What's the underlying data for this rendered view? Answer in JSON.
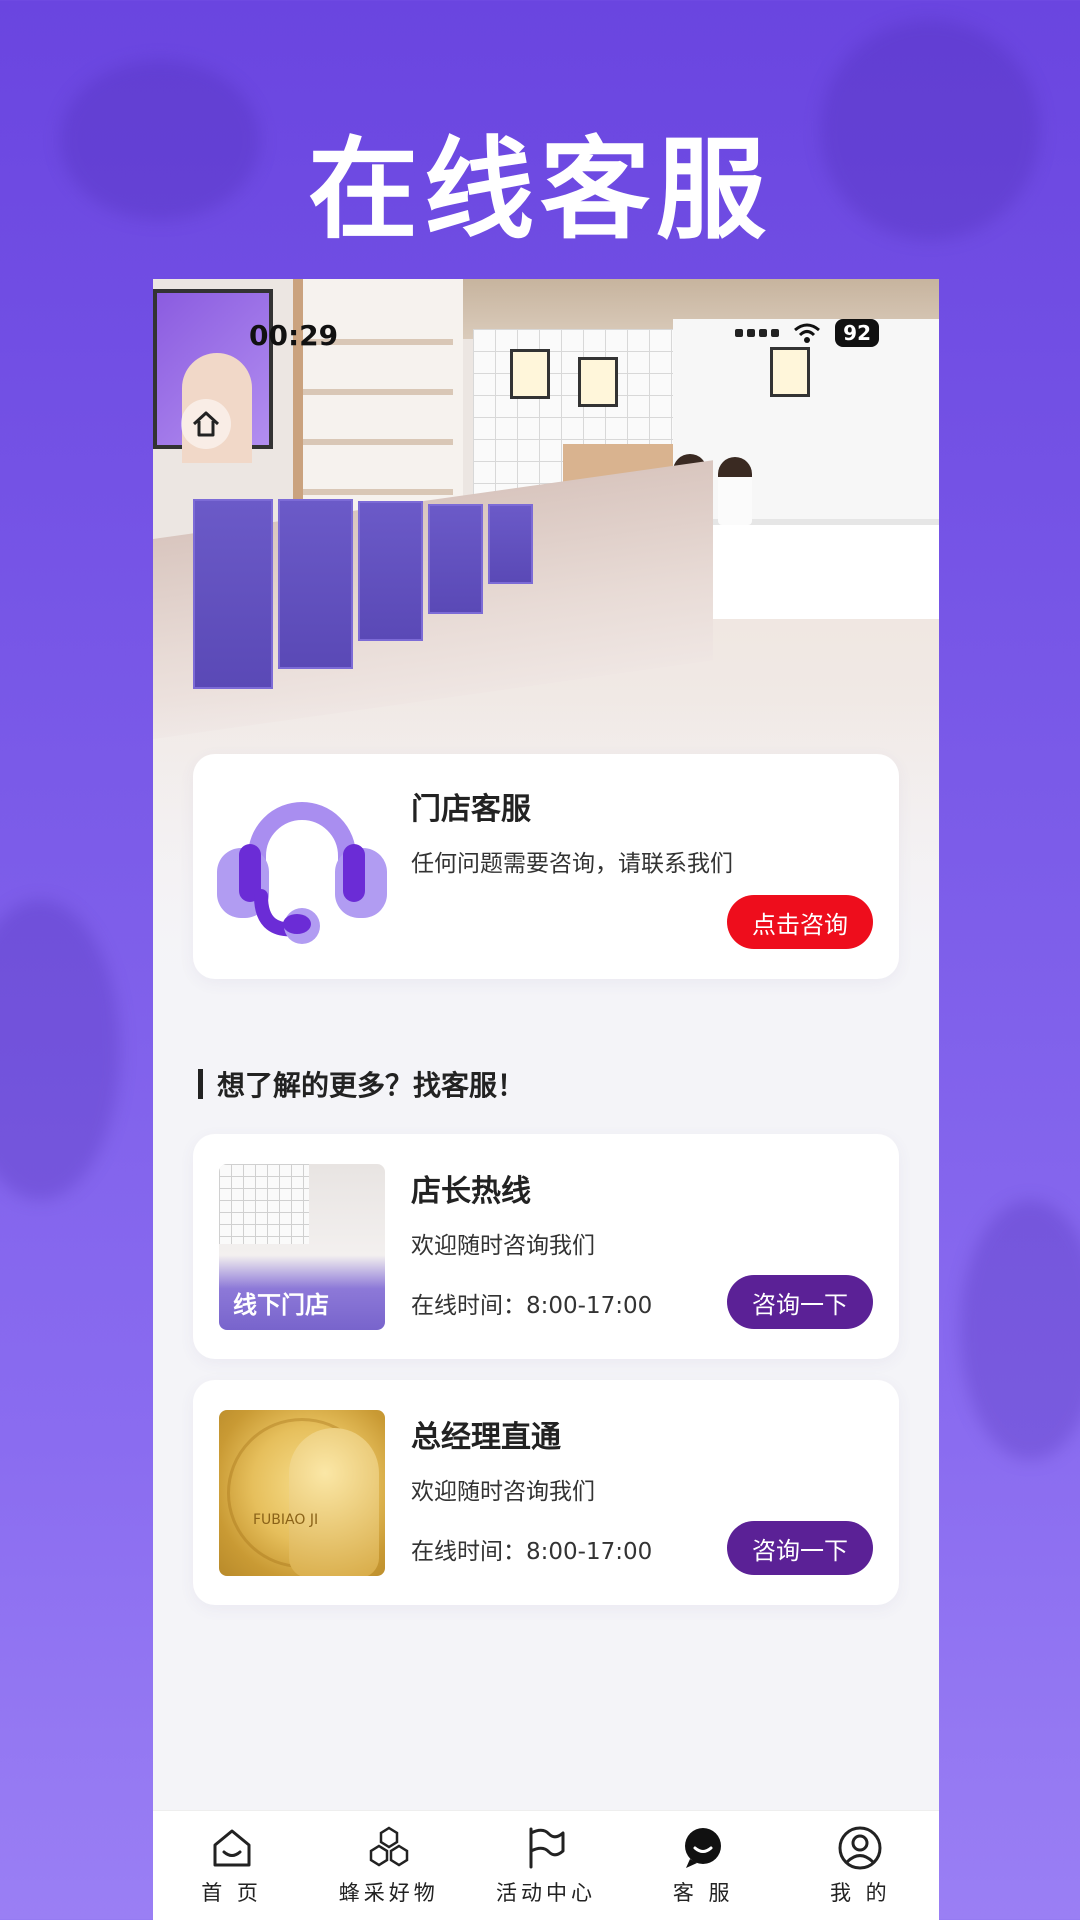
{
  "page_title": "在线客服",
  "status_bar": {
    "time": "00:29",
    "battery": "92"
  },
  "hero": {
    "alt": "store photo"
  },
  "store_card": {
    "title": "门店客服",
    "subtitle": "任何问题需要咨询，请联系我们",
    "button": "点击咨询"
  },
  "section": {
    "heading": "想了解的更多？找客服！"
  },
  "services": [
    {
      "title": "店长热线",
      "desc": "欢迎随时咨询我们",
      "hours": "在线时间：8:00-17:00",
      "image_label": "线下门店",
      "button": "咨询一下"
    },
    {
      "title": "总经理直通",
      "desc": "欢迎随时咨询我们",
      "hours": "在线时间：8:00-17:00",
      "image_label": "FUBIAO JI",
      "button": "咨询一下"
    }
  ],
  "nav": [
    {
      "label": "首 页",
      "icon": "home-icon"
    },
    {
      "label": "蜂采好物",
      "icon": "hexagon-icon"
    },
    {
      "label": "活动中心",
      "icon": "flag-icon"
    },
    {
      "label": "客 服",
      "icon": "chat-icon"
    },
    {
      "label": "我 的",
      "icon": "user-icon"
    }
  ],
  "colors": {
    "accent_red": "#ee0d1c",
    "accent_purple": "#5b2196",
    "brand_purple": "#6a45e0"
  }
}
